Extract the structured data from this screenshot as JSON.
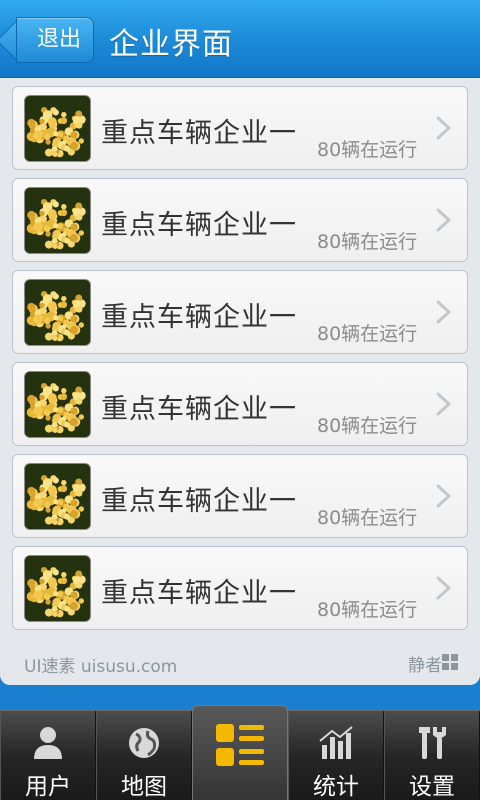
{
  "header": {
    "back_label": "退出",
    "title": "企业界面"
  },
  "list": {
    "items": [
      {
        "name": "重点车辆企业一",
        "status": "80辆在运行"
      },
      {
        "name": "重点车辆企业一",
        "status": "80辆在运行"
      },
      {
        "name": "重点车辆企业一",
        "status": "80辆在运行"
      },
      {
        "name": "重点车辆企业一",
        "status": "80辆在运行"
      },
      {
        "name": "重点车辆企业一",
        "status": "80辆在运行"
      },
      {
        "name": "重点车辆企业一",
        "status": "80辆在运行"
      }
    ]
  },
  "footer": {
    "credit": "UI速素 uisusu.com",
    "brand": "静者"
  },
  "tabs": [
    {
      "label": "用户",
      "icon": "user-icon"
    },
    {
      "label": "地图",
      "icon": "globe-icon"
    },
    {
      "label": "",
      "icon": "list-grid-icon",
      "active": true
    },
    {
      "label": "统计",
      "icon": "chart-icon"
    },
    {
      "label": "设置",
      "icon": "tools-icon"
    }
  ],
  "colors": {
    "header_blue": "#1b8ad8",
    "active_tab_icon": "#f5b800"
  }
}
